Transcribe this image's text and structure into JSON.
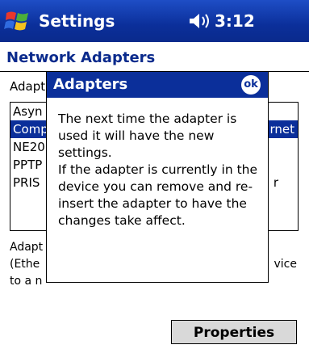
{
  "titlebar": {
    "start_icon": "windows-flag-icon",
    "title": "Settings",
    "volume_icon": "speaker-icon",
    "time": "3:12"
  },
  "page": {
    "header": "Network Adapters"
  },
  "background": {
    "label": "Adapt",
    "list_items": [
      "Asyn",
      "Comp",
      "NE20",
      "PPTP",
      "PRIS"
    ],
    "list_right_fragments": [
      "rnet",
      "r"
    ],
    "description_lines": [
      "Adapt",
      "(Ethe",
      "to a n"
    ],
    "description_right": "vice",
    "properties_label": "Properties"
  },
  "dialog": {
    "title": "Adapters",
    "ok_label": "ok",
    "message": "The next time the adapter is used it will have the new settings.\nIf the adapter is currently in the device you can remove and re-insert the adapter to have the changes take affect."
  },
  "colors": {
    "accent": "#0b2f9a",
    "header_text": "#0a2a8c",
    "button_bg": "#d9d9d9"
  }
}
